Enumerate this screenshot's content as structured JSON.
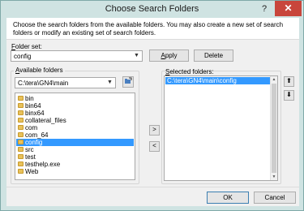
{
  "window": {
    "title": "Choose Search Folders",
    "help": "?",
    "close": "✕"
  },
  "instructions": "Choose the search folders from the available folders. You may also create a new set of search folders or modify an existing set of search folders.",
  "folder_set": {
    "label_prefix": "F",
    "label_rest": "older set:",
    "value": "config",
    "apply_label_u": "A",
    "apply_label_rest": "pply",
    "delete_label": "Delete"
  },
  "available": {
    "label_prefix": "A",
    "label_rest": "vailable folders",
    "path": "C:\\tera\\GN4\\main",
    "items": [
      "bin",
      "bin64",
      "binx64",
      "collateral_files",
      "com",
      "com_64",
      "config",
      "src",
      "test",
      "testhelp.exe",
      "Web"
    ],
    "selected_index": 6
  },
  "selected": {
    "label_prefix": "S",
    "label_rest": "elected folders:",
    "items": [
      "C:\\tera\\GN4\\main\\config"
    ]
  },
  "move_buttons": {
    "add": ">",
    "remove": "<",
    "up": "⬆",
    "down": "⬇"
  },
  "footer": {
    "ok": "OK",
    "cancel": "Cancel"
  }
}
